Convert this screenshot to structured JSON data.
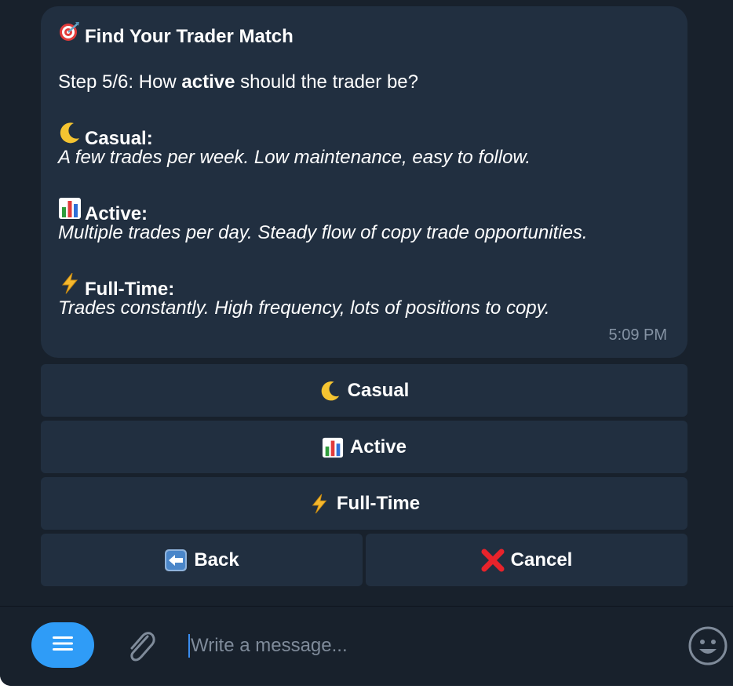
{
  "message": {
    "title_icon": "dart-target-icon",
    "title": "Find Your Trader Match",
    "step_prefix": "Step 5/6: How ",
    "step_bold": "active",
    "step_suffix": " should the trader be?",
    "options": [
      {
        "icon": "crescent-moon-icon",
        "label": "Casual:",
        "description": "A few trades per week. Low maintenance, easy to follow."
      },
      {
        "icon": "bar-chart-icon",
        "label": "Active:",
        "description": "Multiple trades per day. Steady flow of copy trade opportunities."
      },
      {
        "icon": "lightning-icon",
        "label": "Full-Time:",
        "description": "Trades constantly. High frequency, lots of positions to copy."
      }
    ],
    "time": "5:09 PM"
  },
  "keyboard": {
    "casual": {
      "icon": "crescent-moon-icon",
      "label": "Casual"
    },
    "active": {
      "icon": "bar-chart-icon",
      "label": "Active"
    },
    "fulltime": {
      "icon": "lightning-icon",
      "label": "Full-Time"
    },
    "back": {
      "icon": "back-arrow-icon",
      "label": "Back"
    },
    "cancel": {
      "icon": "red-cross-icon",
      "label": "Cancel"
    }
  },
  "composer": {
    "placeholder": "Write a message...",
    "menu_icon": "menu-icon",
    "attach_icon": "paperclip-icon",
    "emoji_icon": "smiley-icon"
  },
  "colors": {
    "background": "#18212c",
    "bubble": "#212f40",
    "accent": "#2f9cf7",
    "muted_text": "#8593a4"
  }
}
